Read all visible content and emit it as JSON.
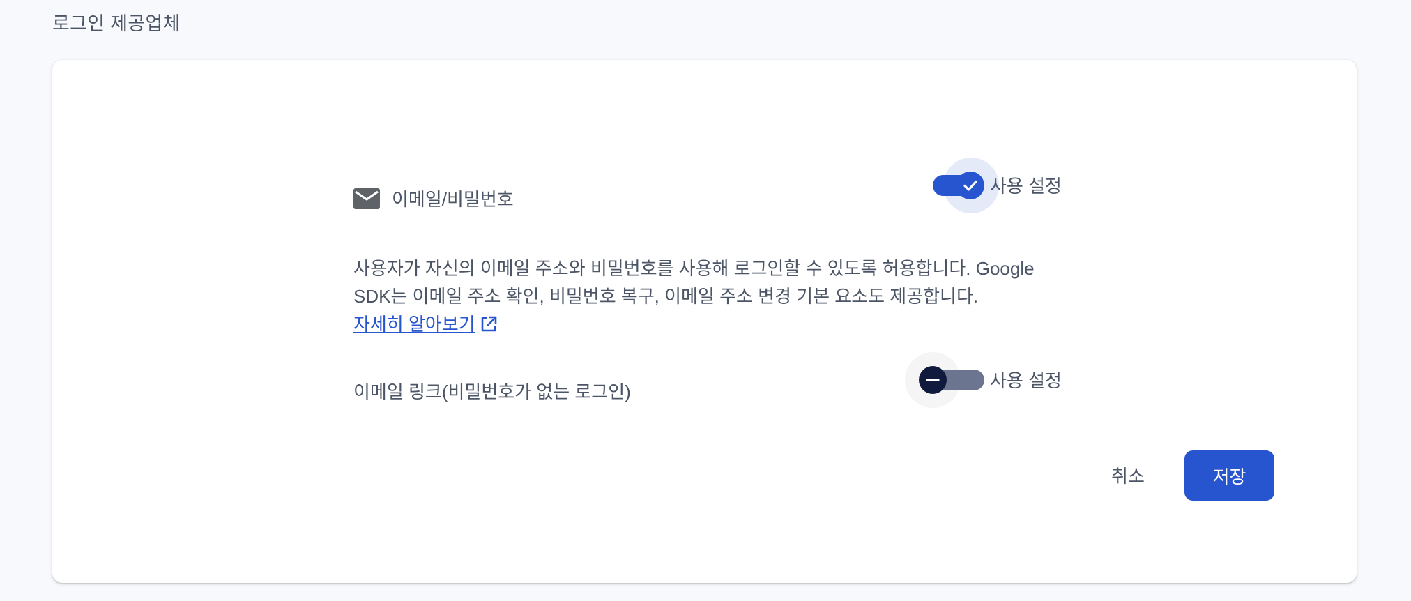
{
  "section": {
    "title": "로그인 제공업체"
  },
  "provider": {
    "icon": "mail-icon",
    "label": "이메일/비밀번호",
    "enabled": true,
    "toggle_label": "사용 설정",
    "description_line1": "사용자가 자신의 이메일 주소와 비밀번호를 사용해 로그인할 수 있도록 허용합니다. Google",
    "description_line2": "SDK는 이메일 주소 확인, 비밀번호 복구, 이메일 주소 변경 기본 요소도 제공합니다.",
    "learn_more": "자세히 알아보기",
    "learn_more_icon": "external-link-icon"
  },
  "email_link": {
    "label": "이메일 링크(비밀번호가 없는 로그인)",
    "enabled": false,
    "toggle_label": "사용 설정"
  },
  "actions": {
    "cancel_label": "취소",
    "save_label": "저장"
  },
  "colors": {
    "accent": "#2755d0",
    "text": "#4c5566",
    "background": "#f8f9fd",
    "card": "#ffffff"
  }
}
